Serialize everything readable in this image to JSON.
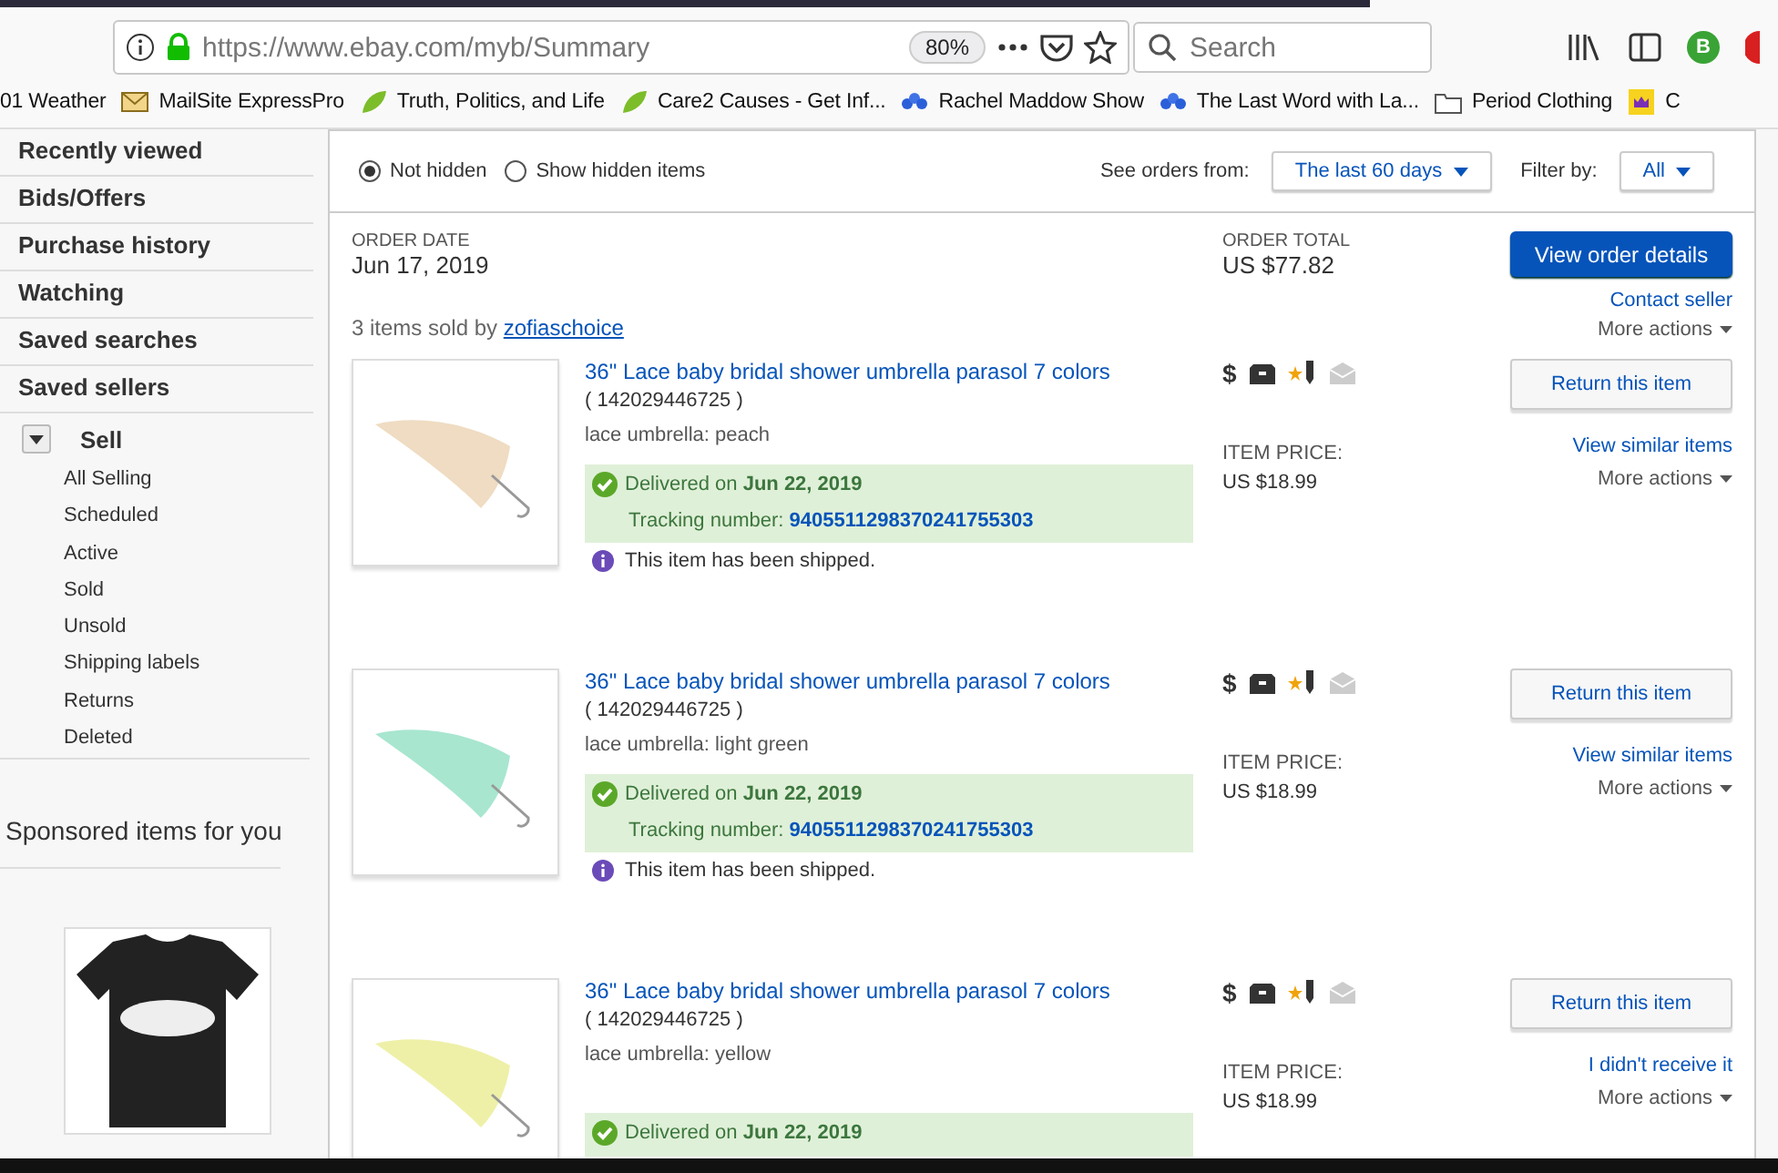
{
  "browser": {
    "url": "https://www.ebay.com/myb/Summary",
    "zoom": "80%",
    "search_placeholder": "Search",
    "profile_initial": "B",
    "bookmarks": [
      {
        "kind": "weather",
        "label": "01 Weather"
      },
      {
        "kind": "mail",
        "label": "MailSite ExpressPro"
      },
      {
        "kind": "leaf",
        "label": "Truth, Politics, and Life"
      },
      {
        "kind": "leaf",
        "label": "Care2 Causes - Get Inf..."
      },
      {
        "kind": "peacock",
        "label": "Rachel Maddow Show"
      },
      {
        "kind": "peacock",
        "label": "The Last Word with La..."
      },
      {
        "kind": "folder",
        "label": "Period Clothing"
      },
      {
        "kind": "crown",
        "label": "C"
      }
    ]
  },
  "sidebar": {
    "items": [
      {
        "label": "Recently viewed"
      },
      {
        "label": "Bids/Offers"
      },
      {
        "label": "Purchase history"
      },
      {
        "label": "Watching"
      },
      {
        "label": "Saved searches"
      },
      {
        "label": "Saved sellers"
      }
    ],
    "sell": {
      "label": "Sell",
      "expanded": true,
      "children": [
        {
          "label": "All Selling"
        },
        {
          "label": "Scheduled"
        },
        {
          "label": "Active"
        },
        {
          "label": "Sold"
        },
        {
          "label": "Unsold"
        },
        {
          "label": "Shipping labels"
        },
        {
          "label": "Returns"
        },
        {
          "label": "Deleted"
        }
      ]
    },
    "sponsored_heading": "Sponsored items for you"
  },
  "filters": {
    "visibility": [
      {
        "label": "Not hidden",
        "selected": true
      },
      {
        "label": "Show hidden items",
        "selected": false
      }
    ],
    "orders_from_label": "See orders from:",
    "orders_from": "The last 60 days",
    "filter_label": "Filter by:",
    "filter": "All"
  },
  "order": {
    "date_label": "ORDER DATE",
    "date": "Jun 17, 2019",
    "total_label": "ORDER TOTAL",
    "total": "US $77.82",
    "details_button": "View order details",
    "sold_by_prefix": "3 items sold by",
    "seller": "zofiaschoice",
    "contact_seller": "Contact seller",
    "more_actions": "More actions",
    "items": [
      {
        "title": "36\" Lace baby bridal shower umbrella parasol 7 colors",
        "item_number": "( 142029446725 )",
        "variation": "lace umbrella: peach",
        "color": "#efdcc2",
        "delivered_prefix": "Delivered on",
        "delivered_date": "Jun 22, 2019",
        "tracking_label": "Tracking number:",
        "tracking": "9405511298370241755303",
        "note": "This item has been shipped.",
        "status_icons": [
          {
            "kind": "paid",
            "symbol": "$",
            "done": true
          },
          {
            "kind": "shipped",
            "done": true
          },
          {
            "kind": "feedback",
            "done": true
          },
          {
            "kind": "message",
            "done": false
          }
        ],
        "price_label": "ITEM PRICE:",
        "price": "US $18.99",
        "return_button": "Return this item",
        "link": "View similar items",
        "more_actions": "More actions"
      },
      {
        "title": "36\" Lace baby bridal shower umbrella parasol 7 colors",
        "item_number": "( 142029446725 )",
        "variation": "lace umbrella: light green",
        "color": "#a8e6cf",
        "delivered_prefix": "Delivered on",
        "delivered_date": "Jun 22, 2019",
        "tracking_label": "Tracking number:",
        "tracking": "9405511298370241755303",
        "note": "This item has been shipped.",
        "status_icons": [
          {
            "kind": "paid",
            "symbol": "$",
            "done": true
          },
          {
            "kind": "shipped",
            "done": true
          },
          {
            "kind": "feedback",
            "done": true
          },
          {
            "kind": "message",
            "done": false
          }
        ],
        "price_label": "ITEM PRICE:",
        "price": "US $18.99",
        "return_button": "Return this item",
        "link": "View similar items",
        "more_actions": "More actions"
      },
      {
        "title": "36\" Lace baby bridal shower umbrella parasol 7 colors",
        "item_number": "( 142029446725 )",
        "variation": "lace umbrella: yellow",
        "color": "#eef0a8",
        "delivered_prefix": "Delivered on",
        "delivered_date": "Jun 22, 2019",
        "status_icons": [
          {
            "kind": "paid",
            "symbol": "$",
            "done": true
          },
          {
            "kind": "shipped",
            "done": true
          },
          {
            "kind": "feedback",
            "done": true
          },
          {
            "kind": "message",
            "done": false
          }
        ],
        "price_label": "ITEM PRICE:",
        "price": "US $18.99",
        "return_button": "Return this item",
        "link": "I didn't receive it",
        "more_actions": "More actions"
      }
    ]
  }
}
